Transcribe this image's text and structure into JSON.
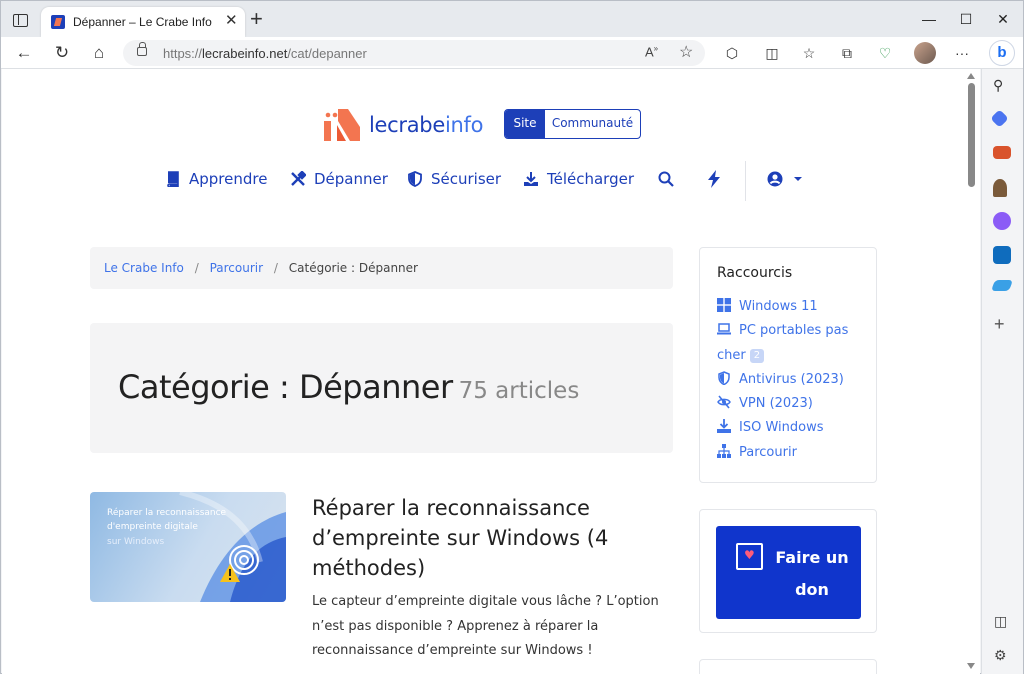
{
  "browser": {
    "tab_title": "Dépanner – Le Crabe Info",
    "url_prefix": "https://",
    "url_host": "lecrabeinfo.net",
    "url_path": "/cat/depanner",
    "close_tab_glyph": "✕",
    "new_tab_glyph": "+"
  },
  "site": {
    "logo_word1": "lecrabe",
    "logo_word2": "info",
    "switch_site": "Site",
    "switch_community": "Communauté",
    "colors": {
      "primary": "#1d3fb8",
      "link": "#3f73e8",
      "accent": "#f37550"
    }
  },
  "nav": {
    "items": [
      {
        "label": "Apprendre",
        "icon": "book-icon"
      },
      {
        "label": "Dépanner",
        "icon": "tools-icon"
      },
      {
        "label": "Sécuriser",
        "icon": "shield-icon"
      },
      {
        "label": "Télécharger",
        "icon": "download-icon"
      }
    ],
    "search_icon": "search-icon",
    "bolt_icon": "bolt-icon",
    "account_icon": "user-circle-icon"
  },
  "breadcrumb": {
    "items": [
      "Le Crabe Info",
      "Parcourir"
    ],
    "current": "Catégorie : Dépanner",
    "separator": "/"
  },
  "category": {
    "title": "Catégorie : Dépanner",
    "count": "75 articles"
  },
  "article": {
    "title": "Réparer la reconnaissance d’empreinte sur Windows (4 méthodes)",
    "excerpt": "Le capteur d’empreinte digitale vous lâche ? L’option n’est pas disponible ? Apprenez à réparer la reconnaissance d’empreinte sur Windows !",
    "thumb_line1": "Réparer la reconnaissance",
    "thumb_line2": "d'empreinte digitale",
    "thumb_line3": "sur Windows"
  },
  "sidebar": {
    "shortcuts_title": "Raccourcis",
    "shortcuts": [
      {
        "label": "Windows 11",
        "icon": "windows-icon"
      },
      {
        "label_line1": "PC portables pas",
        "label_line2": "cher",
        "badge": "2",
        "icon": "laptop-icon"
      },
      {
        "label": "Antivirus (2023)",
        "icon": "shield-icon"
      },
      {
        "label": "VPN (2023)",
        "icon": "eye-slash-icon"
      },
      {
        "label": "ISO Windows",
        "icon": "download-icon"
      },
      {
        "label": "Parcourir",
        "icon": "sitemap-icon"
      }
    ],
    "donate_label": "Faire un don"
  }
}
